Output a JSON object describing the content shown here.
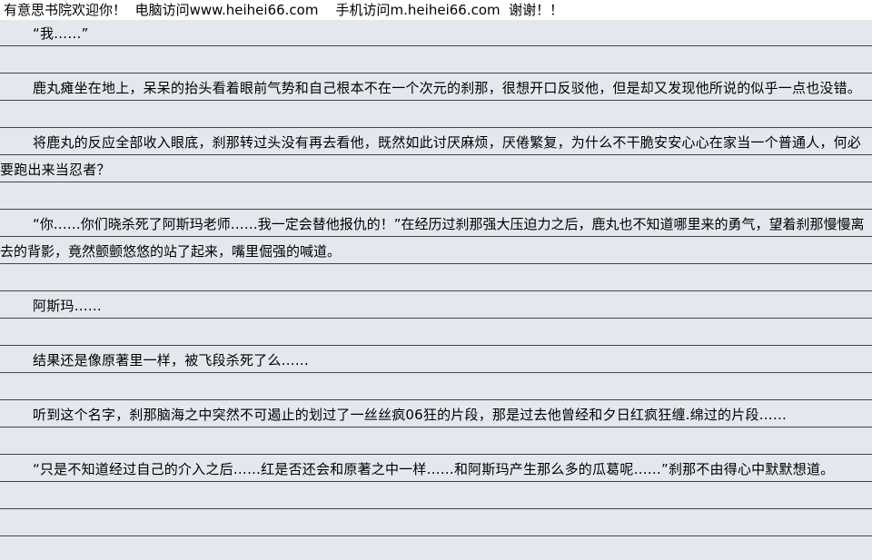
{
  "header": {
    "site_name": "有意思书院欢迎你！",
    "pc_access": "电脑访问www.heihei66.com",
    "mobile_access": "手机访问m.heihei66.com",
    "thanks": "谢谢！！"
  },
  "paragraphs": [
    "“我……”",
    "鹿丸瘫坐在地上，呆呆的抬头看着眼前气势和自己根本不在一个次元的刹那，很想开口反驳他，但是却又发现他所说的似乎一点也没错。",
    "将鹿丸的反应全部收入眼底，刹那转过头没有再去看他，既然如此讨厌麻烦，厌倦繁复，为什么不干脆安安心心在家当一个普通人，何必要跑出来当忍者？",
    "“你……你们晓杀死了阿斯玛老师……我一定会替他报仇的！”在经历过刹那强大压迫力之后，鹿丸也不知道哪里来的勇气，望着刹那慢慢离去的背影，竟然颤颤悠悠的站了起来，嘴里倔强的喊道。",
    "阿斯玛……",
    "结果还是像原著里一样，被飞段杀死了么……",
    "听到这个名字，刹那脑海之中突然不可遏止的划过了一丝丝疯06狂的片段，那是过去他曾经和夕日红疯狂缠.绵过的片段……",
    "“只是不知道经过自己的介入之后……红是否还会和原著之中一样……和阿斯玛产生那么多的瓜葛呢……”刹那不由得心中默默想道。"
  ]
}
